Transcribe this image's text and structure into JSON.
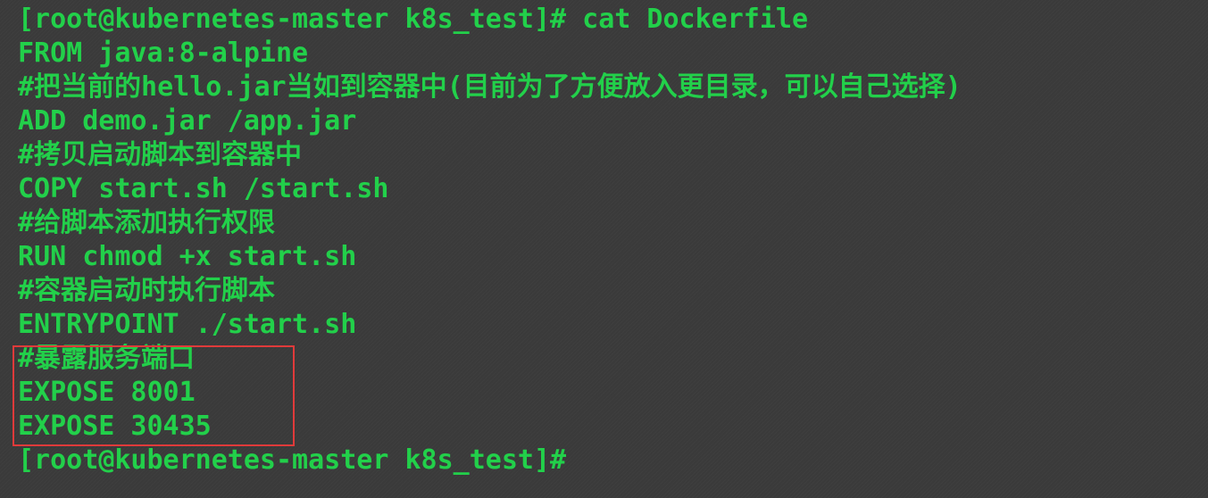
{
  "terminal": {
    "lines": [
      "[root@kubernetes-master k8s_test]# cat Dockerfile",
      "FROM java:8-alpine",
      "#把当前的hello.jar当如到容器中(目前为了方便放入更目录，可以自己选择)",
      "ADD demo.jar /app.jar",
      "#拷贝启动脚本到容器中",
      "COPY start.sh /start.sh",
      "#给脚本添加执行权限",
      "RUN chmod +x start.sh",
      "#容器启动时执行脚本",
      "ENTRYPOINT ./start.sh",
      "#暴露服务端口",
      "EXPOSE 8001",
      "EXPOSE 30435",
      "[root@kubernetes-master k8s_test]#"
    ]
  },
  "colors": {
    "background": "#3a3a3a",
    "text": "#22d04a",
    "highlight_border": "#e03a3a"
  }
}
